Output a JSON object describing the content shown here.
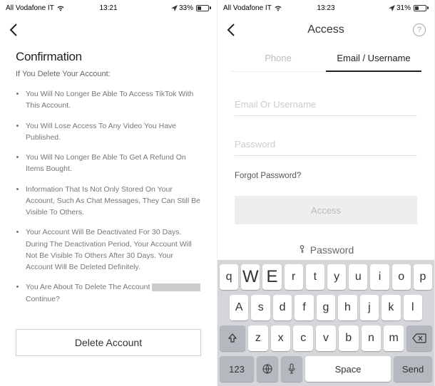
{
  "left": {
    "status": {
      "carrier": "All Vodafone IT",
      "time": "13:21",
      "battery_pct": "33%"
    },
    "title": "Confirmation",
    "subtitle": "If You Delete Your Account:",
    "bullets": [
      "You Will No Longer Be Able To Access TikTok With This Account.",
      "You Will Lose Access To Any Video You Have Published.",
      "You Will No Longer Be Able To Get A Refund On Items Bought.",
      "Information That Is Not Only Stored On Your Account, Such As Chat Messages, They Can Still Be Visible To Others.",
      "Your Account Will Be Deactivated For 30 Days. During The Deactivation Period, Your Account Will Not Be Visible To Others After 30 Days. Your Account Will Be Deleted Definitely.",
      "You Are About To Delete The Account"
    ],
    "continue": "Continue?",
    "delete_btn": "Delete Account"
  },
  "right": {
    "status": {
      "carrier": "All Vodafone IT",
      "time": "13:23",
      "battery_pct": "31%"
    },
    "nav_title": "Access",
    "tabs": {
      "phone": "Phone",
      "email": "Email / Username"
    },
    "form": {
      "email_ph": "Email Or Username",
      "pwd_ph": "Password",
      "forgot": "Forgot Password?",
      "access_btn": "Access"
    },
    "keyboard": {
      "hint": "Password",
      "row1": [
        "q",
        "W",
        "E",
        "r",
        "t",
        "y",
        "u",
        "i",
        "o",
        "p"
      ],
      "row2": [
        "A",
        "s",
        "d",
        "f",
        "g",
        "h",
        "j",
        "k",
        "l"
      ],
      "row3": [
        "z",
        "x",
        "c",
        "v",
        "b",
        "n",
        "m"
      ],
      "num": "123",
      "space": "Space",
      "send": "Send"
    }
  }
}
